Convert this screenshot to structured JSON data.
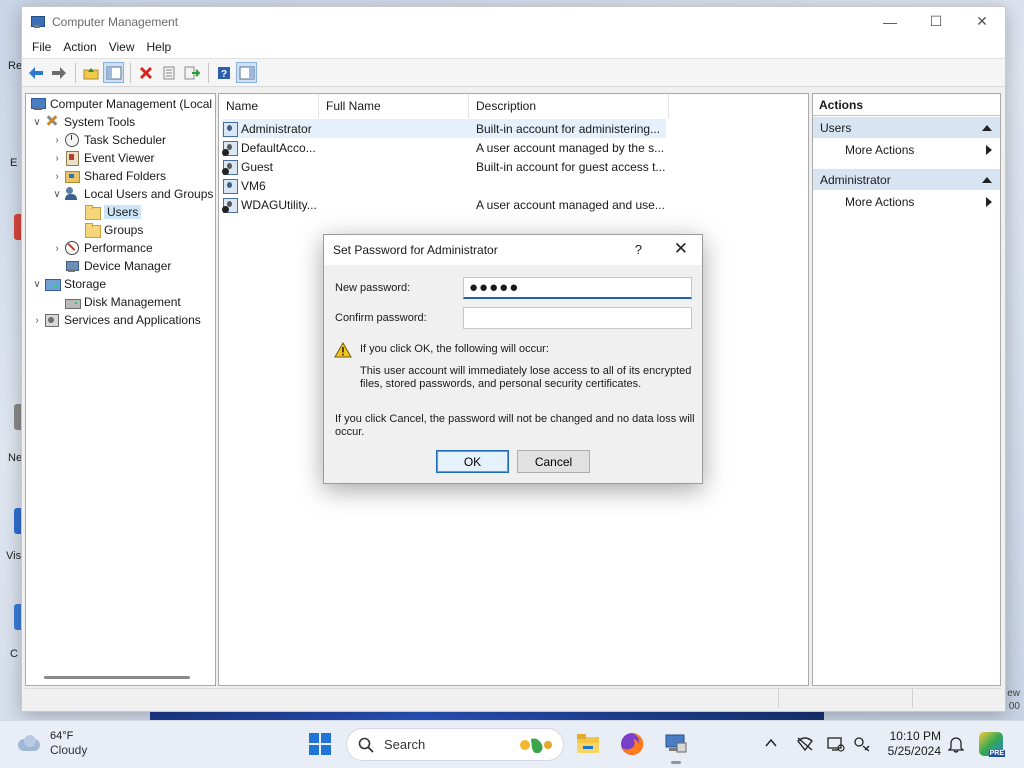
{
  "window": {
    "title": "Computer Management",
    "controls": {
      "minimize": "—",
      "maximize": "☐",
      "close": "✕"
    }
  },
  "menu": [
    "File",
    "Action",
    "View",
    "Help"
  ],
  "tree": [
    {
      "label": "Computer Management (Local",
      "expander": "",
      "icon": "computer-icon"
    },
    {
      "label": "System Tools",
      "expander": "∨",
      "icon": "tools-icon"
    },
    {
      "label": "Task Scheduler",
      "expander": "›",
      "icon": "clock-icon"
    },
    {
      "label": "Event Viewer",
      "expander": "›",
      "icon": "event-viewer-icon"
    },
    {
      "label": "Shared Folders",
      "expander": "›",
      "icon": "shared-folder-icon"
    },
    {
      "label": "Local Users and Groups",
      "expander": "∨",
      "icon": "users-groups-icon"
    },
    {
      "label": "Users",
      "expander": "",
      "icon": "folder-icon"
    },
    {
      "label": "Groups",
      "expander": "",
      "icon": "folder-icon"
    },
    {
      "label": "Performance",
      "expander": "›",
      "icon": "performance-icon"
    },
    {
      "label": "Device Manager",
      "expander": "",
      "icon": "device-manager-icon"
    },
    {
      "label": "Storage",
      "expander": "∨",
      "icon": "storage-icon"
    },
    {
      "label": "Disk Management",
      "expander": "",
      "icon": "disk-icon"
    },
    {
      "label": "Services and Applications",
      "expander": "›",
      "icon": "services-icon"
    }
  ],
  "list": {
    "columns": [
      "Name",
      "Full Name",
      "Description"
    ],
    "rows": [
      {
        "name": "Administrator",
        "full_name": "",
        "description": "Built-in account for administering..."
      },
      {
        "name": "DefaultAcco...",
        "full_name": "",
        "description": "A user account managed by the s..."
      },
      {
        "name": "Guest",
        "full_name": "",
        "description": "Built-in account for guest access t..."
      },
      {
        "name": "VM6",
        "full_name": "",
        "description": ""
      },
      {
        "name": "WDAGUtility...",
        "full_name": "",
        "description": "A user account managed and use..."
      }
    ]
  },
  "actions": {
    "title": "Actions",
    "groups": [
      {
        "label": "Users",
        "item": "More Actions"
      },
      {
        "label": "Administrator",
        "item": "More Actions"
      }
    ]
  },
  "dialog": {
    "title": "Set Password for Administrator",
    "help": "?",
    "close": "✕",
    "new_password_label": "New password:",
    "new_password_value": "●●●●●",
    "confirm_password_label": "Confirm password:",
    "confirm_password_value": "",
    "warning_heading": "If you click OK, the following will occur:",
    "warning_line1": "This user account will immediately lose access to all of its encrypted",
    "warning_line2": "files, stored passwords, and personal security certificates.",
    "cancel_note_line1": "If you click Cancel, the password will not be changed and no data loss will",
    "cancel_note_line2": "occur.",
    "ok_label": "OK",
    "cancel_label": "Cancel"
  },
  "taskbar": {
    "weather_temp": "64°F",
    "weather_condition": "Cloudy",
    "search_label": "Search",
    "time": "10:10 PM",
    "date": "5/25/2024",
    "badge_text": "PRE"
  },
  "desktop": {
    "edge_labels": [
      "Re",
      "E",
      "Ne",
      "Vis",
      "C"
    ],
    "right_labels": [
      "ew",
      "00"
    ]
  }
}
